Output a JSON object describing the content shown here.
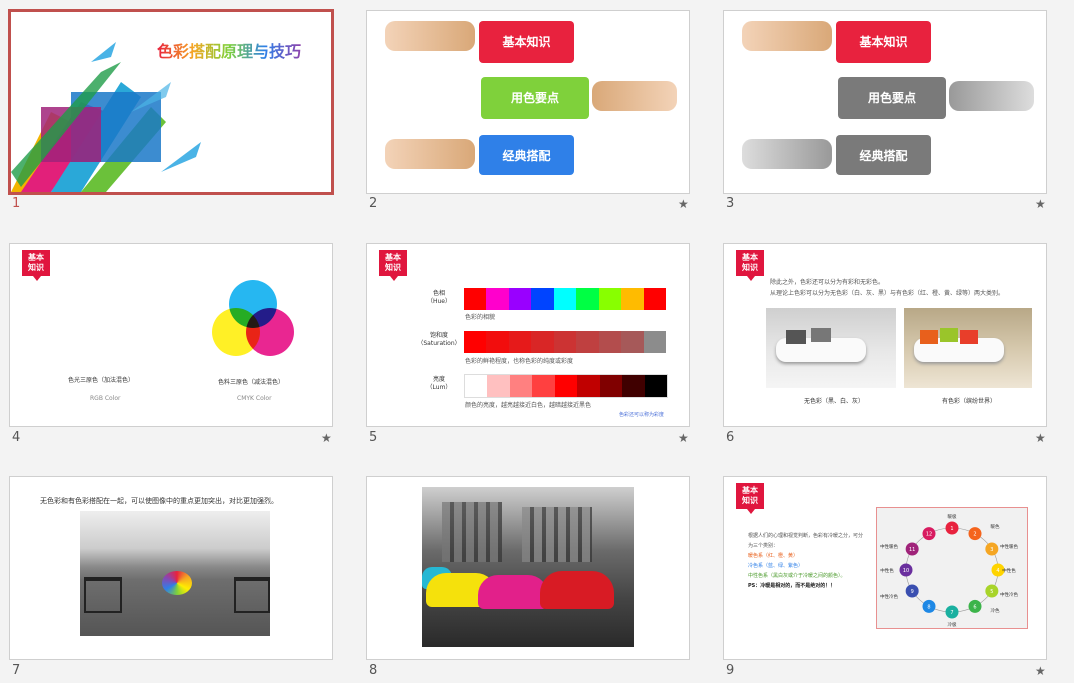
{
  "slides": [
    {
      "num": "1",
      "selected": true,
      "title": "色彩搭配原理与技巧"
    },
    {
      "num": "2",
      "labels": [
        "基本知识",
        "用色要点",
        "经典搭配"
      ],
      "colors": [
        "#e8223e",
        "#7fd13b",
        "#2f80e8"
      ]
    },
    {
      "num": "3",
      "labels": [
        "基本知识",
        "用色要点",
        "经典搭配"
      ],
      "colors": [
        "#e8223e",
        "#7a7a7a",
        "#7a7a7a"
      ]
    },
    {
      "num": "4",
      "tag": "基本\n知识",
      "left_caption": "色光三原色（加法混色）",
      "left_sub": "RGB Color",
      "right_caption": "色料三原色（减法混色）",
      "right_sub": "CMYK Color"
    },
    {
      "num": "5",
      "tag": "基本\n知识",
      "rows": [
        {
          "label": "色相\n（Hue）",
          "note": "色彩的相貌",
          "colors": [
            "#ff0000",
            "#ff00cc",
            "#9900ff",
            "#0044ff",
            "#00ffff",
            "#00ff44",
            "#88ff00",
            "#ffbb00",
            "#ff0000"
          ]
        },
        {
          "label": "饱和度\n（Saturation）",
          "note": "色彩的鲜艳程度，也称色彩的纯度或彩度",
          "colors": [
            "#ff0000",
            "#f20d0d",
            "#e61a1a",
            "#d92626",
            "#cc3333",
            "#bf4040",
            "#b34d4d",
            "#a65959",
            "#8c8c8c"
          ]
        },
        {
          "label": "亮度\n（Lum）",
          "note": "颜色的亮度，越亮越接近白色，越暗越接近黑色",
          "colors": [
            "#ffffff",
            "#ffc0c0",
            "#ff8080",
            "#ff4040",
            "#ff0000",
            "#c00000",
            "#800000",
            "#400000",
            "#000000"
          ]
        }
      ],
      "footnote": "色彩还可以称为彩度"
    },
    {
      "num": "6",
      "tag": "基本\n知识",
      "text1": "除此之外，色彩还可以分为有彩和无彩色。",
      "text2": "从理论上色彩可以分为无色彩（白、灰、黑）与有色彩（红、橙、黄、绿等）两大类别。",
      "cap_left": "无色彩（黑、白、灰）",
      "cap_right": "有色彩（缤纷世界）"
    },
    {
      "num": "7",
      "caption": "无色彩和有色彩搭配在一起，可以使图像中的重点更加突出，对比更加强烈。"
    },
    {
      "num": "8"
    },
    {
      "num": "9",
      "tag": "基本\n知识",
      "lines": [
        "根据人们的心理和视觉判断，色彩有冷暖之分，可分",
        "为三个类别：",
        "暖色系（红、橙、黄）",
        "冷色系（蓝、绿、紫色）",
        "中性色系（黑白灰或介于冷暖之间的颜色）。",
        "PS：冷暖是相对的，而不是绝对的！！"
      ],
      "wheel_labels": [
        "暖极",
        "暖色",
        "中性暖色",
        "中性色",
        "冷色",
        "中性冷色",
        "冷极",
        "中性冷色",
        "中性色",
        "中性暖色"
      ]
    }
  ],
  "star_glyph": "★"
}
